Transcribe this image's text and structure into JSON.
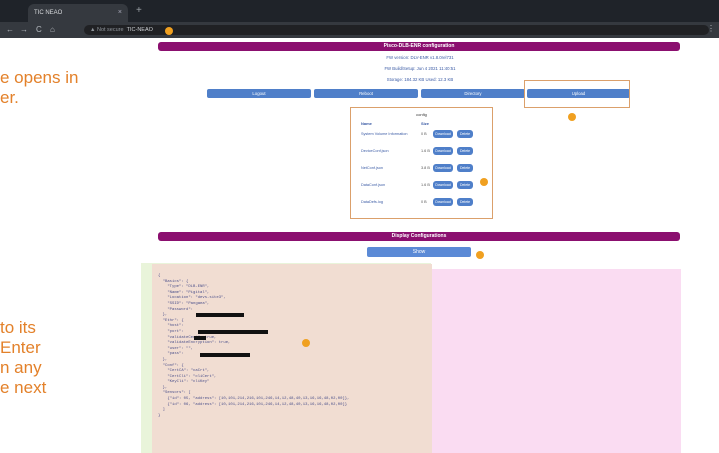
{
  "browser": {
    "tab_title": "TIC NEAO",
    "tab_close": "×",
    "new_tab": "+",
    "nav_back": "←",
    "nav_forward": "→",
    "nav_reload": "C",
    "nav_home": "⌂",
    "not_secure": "▲ Not secure",
    "url": "TIC-NEAO",
    "menu": "⋮"
  },
  "slide": {
    "line1": "e opens in",
    "line2": "er.",
    "line3": "to its",
    "line4": "Enter",
    "line5": "n any",
    "line6": "e next"
  },
  "page": {
    "title": "Pisco-DLB-ENR configuration",
    "fw_version": "FW version: DLV-ENR v1.8.0rel731",
    "fw_build": "FW Build/Setup: Jun 4 2021 11:40:51",
    "storage": "Storage: 184.32 KB  Used: 12.3 KB",
    "nav": {
      "logout": "Logout",
      "reboot": "Reboot",
      "directory": "Directory",
      "upload": "Upload"
    },
    "config": {
      "title": "config",
      "col_name": "Name",
      "col_size": "Size",
      "download_label": "Download",
      "delete_label": "Delete",
      "files": [
        {
          "name": "System Volume Information",
          "size": "0 B"
        },
        {
          "name": "DeviceConf.json",
          "size": "1.6 B"
        },
        {
          "name": "NetConf.json",
          "size": "3.8 B"
        },
        {
          "name": "DataConf.json",
          "size": "1.6 B"
        },
        {
          "name": "DataDefs.log",
          "size": "0 B"
        }
      ]
    },
    "display_title": "Display Configurations",
    "show_button": "Show",
    "json_lines": [
      "{",
      "  \"Basics\": {",
      "    \"Type\": \"DLB-ENR\",",
      "    \"Name\": \"Pigital\",",
      "    \"Location\": \"devs-site3\",",
      "    \"SSID\": \"Pangaea\",",
      "    \"Password\":",
      "  },",
      "  \"Ethr\": {",
      "    \"host\":",
      "    \"port\":",
      "    \"validateCert\": true,",
      "    \"validateEncryption\": true,",
      "    \"user\": \"\",",
      "    \"pass\":",
      "  },",
      "  \"Conf\": {",
      "    \"CertCA\": \"caCrt\",",
      "    \"CertCli\": \"cliCert\",",
      "    \"KeyCli\": \"cliKey\"",
      "  },",
      "  \"Sensors\": [",
      "    {\"id\": 05, \"address\": [10,101,214,216,101,246,14,12,48,40,13,16,16,48,02,00]},",
      "    {\"id\": 06, \"address\": [10,101,214,216,101,246,14,12,48,40,13,16,16,48,02,00]}",
      "  ]",
      "}"
    ]
  },
  "colors": {
    "accent_purple": "#8b0f6f",
    "button_blue": "#4f7fc9",
    "annotation_orange": "#e3812a",
    "highlight_green": "#e9f4da",
    "highlight_pink": "#fadcf2"
  }
}
